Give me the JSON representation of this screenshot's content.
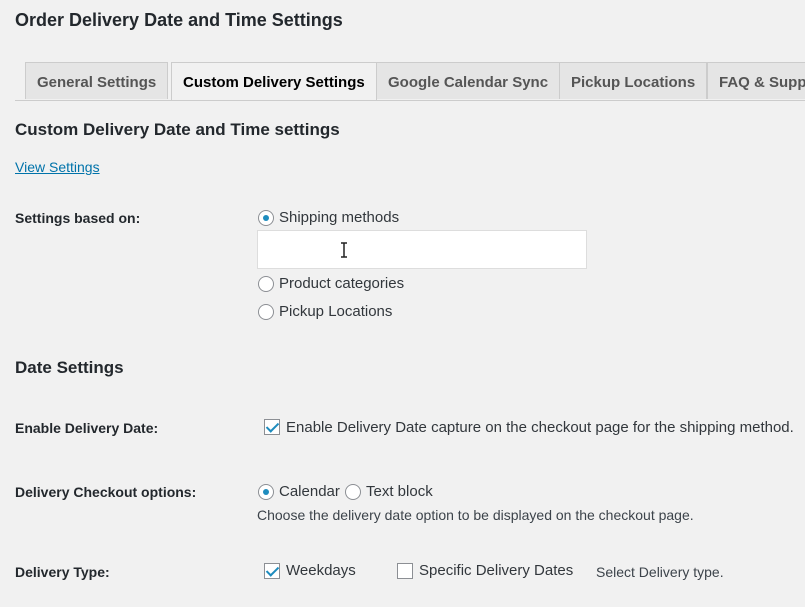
{
  "page": {
    "title": "Order Delivery Date and Time Settings"
  },
  "tabs": [
    {
      "label": "General Settings"
    },
    {
      "label": "Custom Delivery Settings"
    },
    {
      "label": "Google Calendar Sync"
    },
    {
      "label": "Pickup Locations"
    },
    {
      "label": "FAQ & Support"
    }
  ],
  "custom_section": {
    "title": "Custom Delivery Date and Time settings",
    "view_link": "View Settings",
    "settings_based_on": {
      "label": "Settings based on:",
      "options": [
        "Shipping methods",
        "Product categories",
        "Pickup Locations"
      ],
      "selected": "Shipping methods",
      "shipping_select_value": ""
    }
  },
  "date_settings": {
    "title": "Date Settings",
    "enable_delivery_date": {
      "label": "Enable Delivery Date:",
      "checkbox_label": "Enable Delivery Date capture on the checkout page for the shipping method.",
      "checked": true
    },
    "checkout_options": {
      "label": "Delivery Checkout options:",
      "options": [
        "Calendar",
        "Text block"
      ],
      "selected": "Calendar",
      "description": "Choose the delivery date option to be displayed on the checkout page."
    },
    "delivery_type": {
      "label": "Delivery Type:",
      "weekdays": "Weekdays",
      "weekdays_checked": true,
      "specific_dates": "Specific Delivery Dates",
      "specific_checked": false,
      "description": "Select Delivery type."
    }
  },
  "colors": {
    "accent": "#1e8cbe",
    "link": "#0073aa",
    "background": "#f1f1f1"
  },
  "icons": {
    "text_cursor": "text-cursor-icon"
  }
}
